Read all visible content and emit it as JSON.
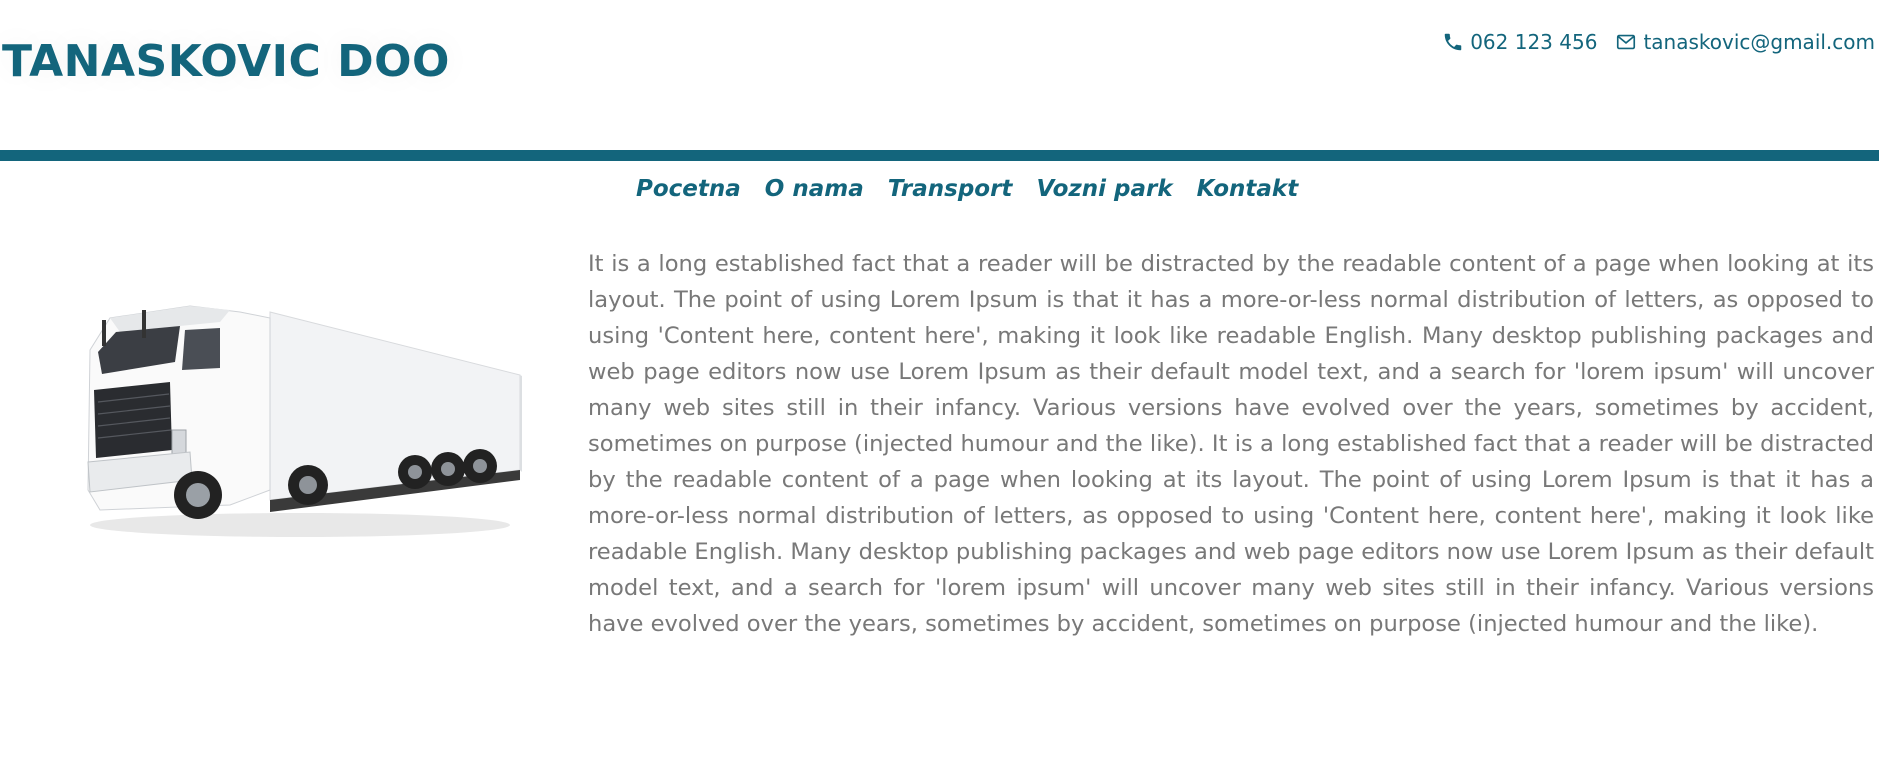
{
  "header": {
    "brand": "TANASKOVIC DOO",
    "phone": "062 123 456",
    "email": "tanaskovic@gmail.com"
  },
  "nav": {
    "items": [
      "Pocetna",
      "O nama",
      "Transport",
      "Vozni park",
      "Kontakt"
    ]
  },
  "main": {
    "image_alt_icon": "truck-illustration",
    "body_text": "It is a long established fact that a reader will be distracted by the readable content of a page when looking at its layout. The point of using Lorem Ipsum is that it has a more-or-less normal distribution of letters, as opposed to using 'Content here, content here', making it look like readable English. Many desktop publishing packages and web page editors now use Lorem Ipsum as their default model text, and a search for 'lorem ipsum' will uncover many web sites still in their infancy. Various versions have evolved over the years, sometimes by accident, sometimes on purpose (injected humour and the like). It is a long established fact that a reader will be distracted by the readable content of a page when looking at its layout. The point of using Lorem Ipsum is that it has a more-or-less normal distribution of letters, as opposed to using 'Content here, content here', making it look like readable English. Many desktop publishing packages and web page editors now use Lorem Ipsum as their default model text, and a search for 'lorem ipsum' will uncover many web sites still in their infancy. Various versions have evolved over the years, sometimes by accident, sometimes on purpose (injected humour and the like)."
  },
  "colors": {
    "brand": "#13657c",
    "text": "#787878",
    "background": "#ffffff"
  }
}
